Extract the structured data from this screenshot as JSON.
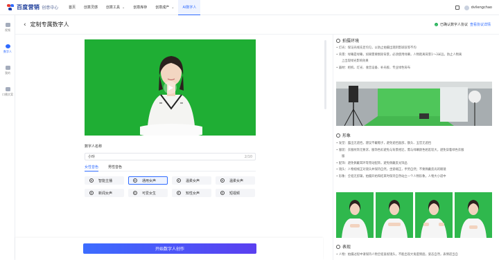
{
  "app": {
    "logo_text": "百度营销",
    "logo_sub": "创意中心"
  },
  "nav": {
    "items": [
      {
        "label": "首页",
        "dropdown": false,
        "active": false
      },
      {
        "label": "创意灵感",
        "dropdown": false,
        "active": false
      },
      {
        "label": "创意工具",
        "dropdown": true,
        "active": false
      },
      {
        "label": "创意库存",
        "dropdown": false,
        "active": false
      },
      {
        "label": "创意成产",
        "dropdown": true,
        "active": false
      },
      {
        "label": "AI数字人",
        "dropdown": false,
        "active": true
      }
    ],
    "username": "dvilengchao",
    "dropdown_icon": "chevron-down-icon"
  },
  "sidebar": {
    "items": [
      {
        "label": "视频",
        "icon": "video-icon",
        "active": false
      },
      {
        "label": "数字人",
        "icon": "digital-human-icon",
        "active": true
      },
      {
        "label": "我的",
        "icon": "user-icon",
        "active": false
      },
      {
        "label": "口播文案",
        "icon": "script-icon",
        "active": false
      }
    ]
  },
  "header": {
    "back_icon": "‹",
    "title": "定制专属数字人",
    "verify_text": "已确认数字人协议",
    "verify_link": "查看协议详情"
  },
  "form": {
    "name_label": "数字人名称",
    "name_value": "小玲",
    "name_count": "2/10",
    "tabs": [
      "女性音色",
      "男性音色"
    ],
    "active_tab": 0,
    "voices": [
      {
        "label": "智能主播",
        "selected": false
      },
      {
        "label": "通用女声",
        "selected": true
      },
      {
        "label": "温柔女声",
        "selected": false
      },
      {
        "label": "温柔女声",
        "selected": false
      },
      {
        "label": "新闻女声",
        "selected": false
      },
      {
        "label": "可爱女生",
        "selected": false
      },
      {
        "label": "知性女声",
        "selected": false
      },
      {
        "label": "短视频",
        "selected": false
      }
    ],
    "start_button": "开始数字人创作"
  },
  "guide": {
    "sections": [
      {
        "title": "拍摄环境",
        "icon": "camera-icon",
        "lines": [
          "• 灯光：保证光线充足均匀，以防止拍摄出现阴影斑驳等不均",
          "• 背景：绿幕是绿幕，如果需要剔除背景，必须使用绿幕，人物距离背景1～3米远，防止人物离",
          "  上出现绿光影响效果",
          "• 器材：相机、灯光、收音设备、补光板、专业绿色背布"
        ]
      },
      {
        "title": "形象",
        "icon": "person-icon",
        "lines": [
          "• 发型：露出无遮挡，建议不戴帽子，避免遮挡面部，额头、五官无遮挡",
          "• 服装：衣服纹饰无要求，服饰色彩避免与背景相近，需与绿幕颜色相差较大，避免穿着绿色衣服",
          "  服",
          "• 配饰：避免佩戴耳环等晃动配饰，避免佩戴反光饰品",
          "• 镜头：人物视线正对镜头并保持自然，坐姿端正，手势自然；不要佩戴反光的眼镜",
          "• 形象：全程无剪辑，拍摄开始和结束时保持自然站立一个人物形象，人物大小适中"
        ]
      },
      {
        "title": "表现",
        "icon": "smile-icon",
        "lines": [
          "• 人物：拍摄过程中请保持人物全程直视镜头，不能出现大角度侧面，姿态自然，表情适当自"
        ]
      }
    ]
  },
  "colors": {
    "accent": "#2f6bff",
    "green_screen": "#1fae34",
    "button_gradient_start": "#3c6cff",
    "button_gradient_end": "#5a3ff0",
    "verify_green": "#26b35a"
  }
}
